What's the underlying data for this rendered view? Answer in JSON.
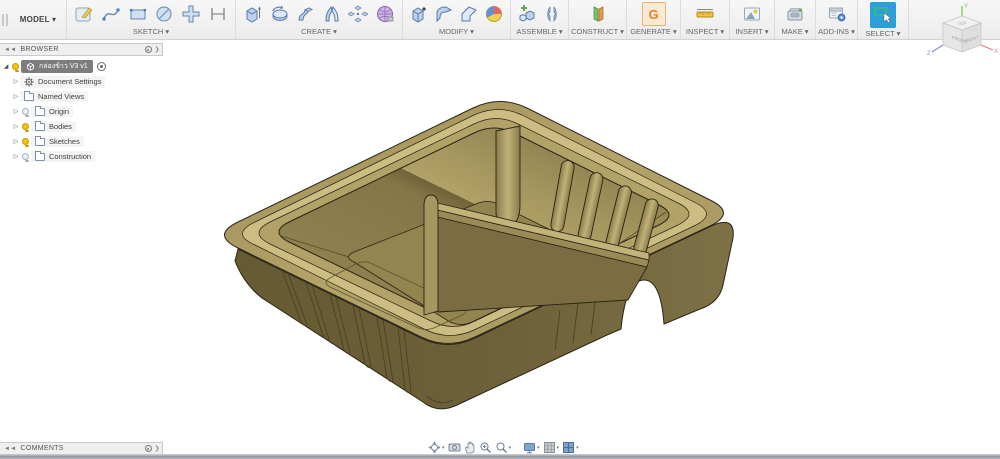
{
  "toolbar": {
    "model_label": "MODEL ▾",
    "groups": [
      {
        "label": "SKETCH ▾"
      },
      {
        "label": "CREATE ▾"
      },
      {
        "label": "MODIFY ▾"
      },
      {
        "label": "ASSEMBLE ▾"
      },
      {
        "label": "CONSTRUCT ▾"
      },
      {
        "label": "GENERATE ▾"
      },
      {
        "label": "INSPECT ▾"
      },
      {
        "label": "INSERT ▾"
      },
      {
        "label": "MAKE ▾"
      },
      {
        "label": "ADD-INS ▾"
      },
      {
        "label": "SELECT ▾"
      }
    ],
    "generate_letter": "G"
  },
  "browser": {
    "title": "BROWSER",
    "collapse_glyph": "◄◄",
    "root": {
      "label": "กล่องข้าว V3 v1"
    },
    "items": [
      {
        "label": "Document Settings"
      },
      {
        "label": "Named Views"
      },
      {
        "label": "Origin"
      },
      {
        "label": "Bodies"
      },
      {
        "label": "Sketches"
      },
      {
        "label": "Construction"
      }
    ]
  },
  "comments": {
    "title": "COMMENTS",
    "collapse_glyph": "◄◄"
  },
  "viewcube": {
    "top": "TOP",
    "front": "FRONT",
    "right": "RIGHT",
    "axis_x": "X",
    "axis_y": "Y",
    "axis_z": "Z"
  },
  "model": {
    "description": "two-compartment plastic food tray, isometric view",
    "body_color": "#8d7e4f",
    "rim_highlight": "#c9b97e",
    "outline_color": "#2a2415"
  },
  "colors": {
    "select_active_blue": "#2a9fd8",
    "bulb_on_yellow": "#f6c40a",
    "generate_orange": "#e8832a",
    "toolbar_bg": "#f0f0f0"
  }
}
